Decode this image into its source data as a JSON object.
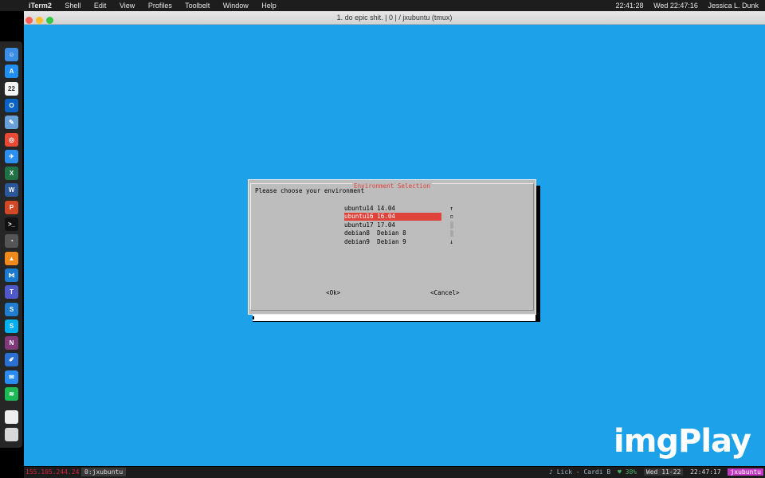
{
  "menubar": {
    "apple": "",
    "app_name": "iTerm2",
    "items": [
      "Shell",
      "Edit",
      "View",
      "Profiles",
      "Toolbelt",
      "Window",
      "Help"
    ],
    "right_items": [
      "22:41:28",
      "Wed 22:47:16",
      "Jessica L. Dunk"
    ]
  },
  "window": {
    "title": "1. do epic shit. | 0 | / jxubuntu (tmux)",
    "lights": [
      "#fc5f57",
      "#fdbc2e",
      "#33c748"
    ]
  },
  "dock": {
    "apps": [
      {
        "name": "finder-icon",
        "color": "#3a8ee6",
        "glyph": "☺"
      },
      {
        "name": "app-store-icon",
        "color": "#1f8ff2",
        "glyph": "A"
      },
      {
        "name": "calendar-icon",
        "color": "#f4f4f4",
        "glyph": "22"
      },
      {
        "name": "outlook-icon",
        "color": "#0a64c8",
        "glyph": "O"
      },
      {
        "name": "preview-icon",
        "color": "#6aa0d8",
        "glyph": "✎"
      },
      {
        "name": "chrome-icon",
        "color": "#e94a35",
        "glyph": "◎"
      },
      {
        "name": "safari-icon",
        "color": "#2a8ff0",
        "glyph": "✈"
      },
      {
        "name": "excel-icon",
        "color": "#1f7244",
        "glyph": "X"
      },
      {
        "name": "word-icon",
        "color": "#2b579a",
        "glyph": "W"
      },
      {
        "name": "powerpoint-icon",
        "color": "#d24726",
        "glyph": "P"
      },
      {
        "name": "terminal-icon",
        "color": "#111111",
        "glyph": ">_"
      },
      {
        "name": "activity-monitor-icon",
        "color": "#555555",
        "glyph": "◔"
      },
      {
        "name": "vlc-icon",
        "color": "#f08a1c",
        "glyph": "▲"
      },
      {
        "name": "vscode-icon",
        "color": "#1a7bd0",
        "glyph": "⋈"
      },
      {
        "name": "teams-icon",
        "color": "#5059c9",
        "glyph": "T"
      },
      {
        "name": "skype-business-icon",
        "color": "#1f7ccf",
        "glyph": "S"
      },
      {
        "name": "skype-icon",
        "color": "#00aff0",
        "glyph": "S"
      },
      {
        "name": "onenote-icon",
        "color": "#80397b",
        "glyph": "N"
      },
      {
        "name": "paintbrush-icon",
        "color": "#2a6fd2",
        "glyph": "✐"
      },
      {
        "name": "messenger-icon",
        "color": "#2a8cf0",
        "glyph": "✉"
      },
      {
        "name": "spotify-icon",
        "color": "#1db954",
        "glyph": "≋"
      },
      {
        "name": "document-icon",
        "color": "#eeeeee",
        "glyph": " "
      },
      {
        "name": "trash-icon",
        "color": "#d8d8d8",
        "glyph": " "
      }
    ]
  },
  "dialog": {
    "title": "Environment Selection",
    "prompt": "Please choose your environment",
    "items": [
      {
        "tag": "ubuntu14",
        "label": "14.04"
      },
      {
        "tag": "ubuntu16",
        "label": "16.04"
      },
      {
        "tag": "ubuntu17",
        "label": "17.04"
      },
      {
        "tag": "debian8",
        "label": "Debian 8"
      },
      {
        "tag": "debian9",
        "label": "Debian 9"
      }
    ],
    "item_lines": [
      "ubuntu14 14.04",
      "ubuntu16 16.04",
      "ubuntu17 17.04",
      "debian8  Debian 8",
      "debian9  Debian 9"
    ],
    "selected_index": 1,
    "scroll_up": "↑",
    "scroll_down": "↓",
    "scroll_thumb": "▫",
    "ok_button": "<Ok>",
    "cancel_button": "<Cancel>"
  },
  "tmux": {
    "ip": "155.105.244.24",
    "window": "0:jxubuntu",
    "music": "♪ Lick - Cardi B",
    "battery": "♥ 38%",
    "date": "Wed 11-22",
    "time": "22:47:17",
    "host": "jxubuntu",
    "colors": {
      "music": "#9fb6c3",
      "battery": "#49b06b",
      "date_bg": "#333333",
      "host": "#c23ac2"
    }
  },
  "watermark": {
    "text": "imgPlay"
  },
  "colors": {
    "terminal_bg": "#1da1e8",
    "dialog_bg": "#bdbdbd",
    "accent_red": "#e0433a"
  }
}
